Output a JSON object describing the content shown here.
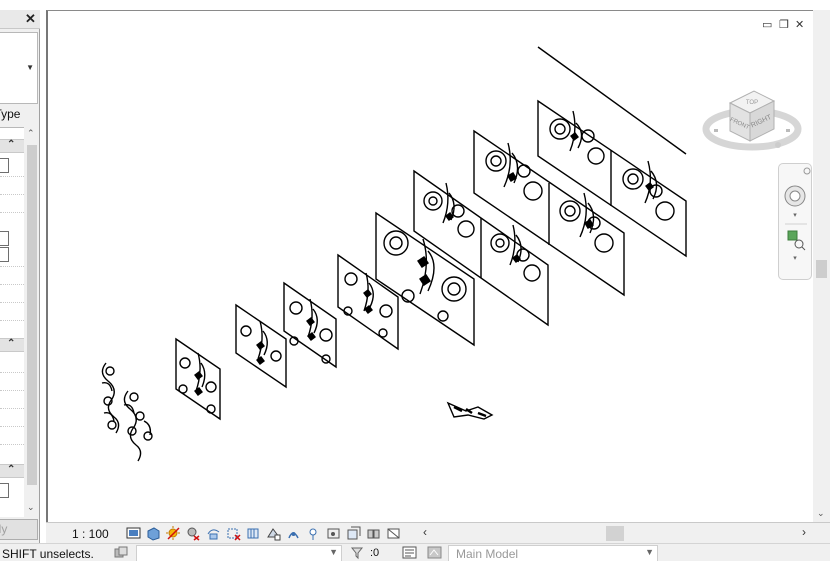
{
  "properties_panel": {
    "close_glyph": "✕",
    "type_label": "t Type",
    "apply_label": "ply"
  },
  "viewport": {
    "window_controls": [
      "minimize",
      "restore",
      "close"
    ],
    "viewcube": {
      "top_label": "TOP",
      "front_label": "FRONT",
      "right_label": "RIGHT"
    }
  },
  "view_control_bar": {
    "scale": "1 : 100",
    "icons": [
      "detail-level-icon",
      "visual-style-icon",
      "sun-path-icon",
      "shadows-icon",
      "crop-view-icon",
      "show-crop-icon",
      "temporary-hide-icon",
      "reveal-hidden-icon",
      "lock-view-icon",
      "worksharing-icon",
      "analytical-icon",
      "highlight-displacement-icon",
      "constraints-icon",
      "preview-icon",
      "hide-analytical-icon"
    ]
  },
  "status_bar": {
    "message": "SHIFT unselects.",
    "selection_count": ":0",
    "active_model": "Main Model"
  },
  "colors": {
    "panel_bg": "#f0f0f0",
    "drawing_line": "#000000",
    "viewcube_face": "#e6e6e6"
  }
}
